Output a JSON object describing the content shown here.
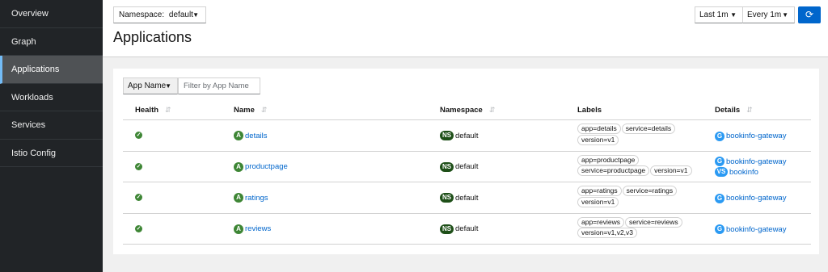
{
  "sidebar": {
    "items": [
      {
        "label": "Overview"
      },
      {
        "label": "Graph"
      },
      {
        "label": "Applications"
      },
      {
        "label": "Workloads"
      },
      {
        "label": "Services"
      },
      {
        "label": "Istio Config"
      }
    ]
  },
  "header": {
    "namespace_label": "Namespace:",
    "namespace_value": "default",
    "title": "Applications",
    "time_range": "Last 1m",
    "refresh_interval": "Every 1m"
  },
  "filter": {
    "type": "App Name",
    "placeholder": "Filter by App Name"
  },
  "table": {
    "columns": {
      "health": "Health",
      "name": "Name",
      "namespace": "Namespace",
      "labels": "Labels",
      "details": "Details"
    },
    "rows": [
      {
        "name": "details",
        "namespace": "default",
        "labels": [
          "app=details",
          "service=details",
          "version=v1"
        ],
        "details": [
          {
            "badge": "G",
            "text": "bookinfo-gateway"
          }
        ]
      },
      {
        "name": "productpage",
        "namespace": "default",
        "labels": [
          "app=productpage",
          "service=productpage",
          "version=v1"
        ],
        "details": [
          {
            "badge": "G",
            "text": "bookinfo-gateway"
          },
          {
            "badge": "VS",
            "text": "bookinfo"
          }
        ]
      },
      {
        "name": "ratings",
        "namespace": "default",
        "labels": [
          "app=ratings",
          "service=ratings",
          "version=v1"
        ],
        "details": [
          {
            "badge": "G",
            "text": "bookinfo-gateway"
          }
        ]
      },
      {
        "name": "reviews",
        "namespace": "default",
        "labels": [
          "app=reviews",
          "service=reviews",
          "version=v1,v2,v3"
        ],
        "details": [
          {
            "badge": "G",
            "text": "bookinfo-gateway"
          }
        ]
      }
    ]
  },
  "badges": {
    "app": "A",
    "namespace": "NS"
  },
  "colors": {
    "accent": "#0066cc",
    "healthy": "#3e8635",
    "sidebar": "#212427"
  }
}
